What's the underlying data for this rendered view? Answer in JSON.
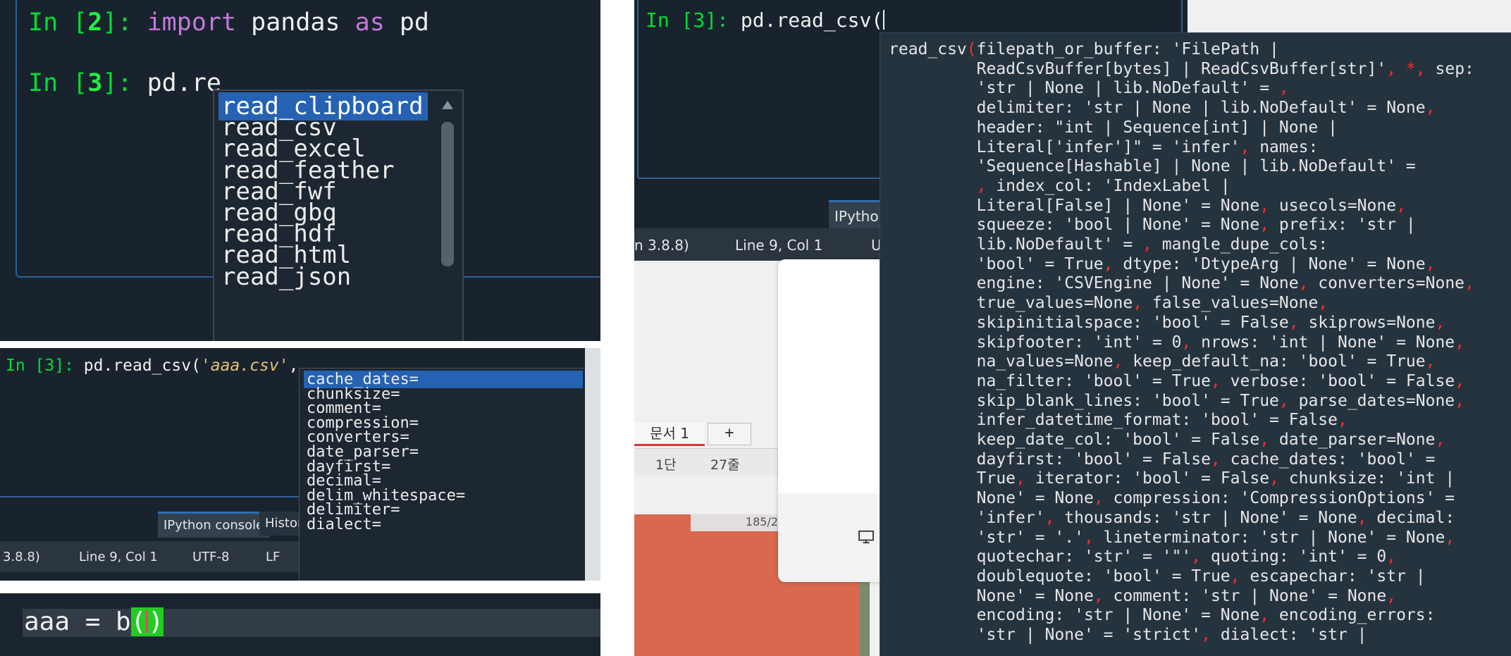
{
  "panelA": {
    "lines": [
      {
        "prompt_in": "In [",
        "num": "2",
        "prompt_close": "]:",
        "code": [
          {
            "kind": "kw",
            "text": "import"
          },
          {
            "kind": "plain",
            "text": " pandas "
          },
          {
            "kind": "kw",
            "text": "as"
          },
          {
            "kind": "plain",
            "text": " pd"
          }
        ]
      },
      {
        "prompt_in": "In [",
        "num": "3",
        "prompt_close": "]:",
        "code": [
          {
            "kind": "plain",
            "text": "pd.re"
          }
        ]
      }
    ],
    "completions": [
      "read_clipboard",
      "read_csv",
      "read_excel",
      "read_feather",
      "read_fwf",
      "read_gbq",
      "read_hdf",
      "read_html",
      "read_json"
    ],
    "selected_index": 0
  },
  "panelB": {
    "prompt": "In [3]:",
    "code_prefix": " pd.read_csv(",
    "code_string": "'aaa.csv'",
    "code_suffix": ",",
    "completions": [
      "cache_dates=",
      "chunksize=",
      "comment=",
      "compression=",
      "converters=",
      "date_parser=",
      "dayfirst=",
      "decimal=",
      "delim_whitespace=",
      "delimiter=",
      "dialect="
    ],
    "selected_index": 0,
    "tabs": [
      "IPython console",
      "Histor"
    ],
    "status": [
      "3.8.8)",
      "Line 9, Col 1",
      "UTF-8",
      "LF"
    ]
  },
  "panelC": {
    "code_before": "aaa = b",
    "paren_open": "(",
    "paren_close": ")"
  },
  "panelD": {
    "prompt": "In [3]:",
    "code": " pd.read_csv(",
    "tab": "IPytho",
    "status": [
      "n 3.8.8)",
      "Line 9, Col 1",
      "U"
    ],
    "hwp_tab": "문서 1",
    "plus_tab": "+",
    "ruler": [
      "1단",
      "27줄"
    ],
    "page_num": "185/2",
    "signature_lines": [
      "read_csv(filepath_or_buffer: 'FilePath |",
      "         ReadCsvBuffer[bytes] | ReadCsvBuffer[str]', *, sep:",
      "         'str | None | lib.NoDefault' = ,",
      "         delimiter: 'str | None | lib.NoDefault' = None,",
      "         header: \"int | Sequence[int] | None |",
      "         Literal['infer']\" = 'infer', names:",
      "         'Sequence[Hashable] | None | lib.NoDefault' =",
      "         , index_col: 'IndexLabel |",
      "         Literal[False] | None' = None, usecols=None,",
      "         squeeze: 'bool | None' = None, prefix: 'str |",
      "         lib.NoDefault' = , mangle_dupe_cols:",
      "         'bool' = True, dtype: 'DtypeArg | None' = None,",
      "         engine: 'CSVEngine | None' = None, converters=None,",
      "         true_values=None, false_values=None,",
      "         skipinitialspace: 'bool' = False, skiprows=None,",
      "         skipfooter: 'int' = 0, nrows: 'int | None' = None,",
      "         na_values=None, keep_default_na: 'bool' = True,",
      "         na_filter: 'bool' = True, verbose: 'bool' = False,",
      "         skip_blank_lines: 'bool' = True, parse_dates=None,",
      "         infer_datetime_format: 'bool' = False,",
      "         keep_date_col: 'bool' = False, date_parser=None,",
      "         dayfirst: 'bool' = False, cache_dates: 'bool' =",
      "         True, iterator: 'bool' = False, chunksize: 'int |",
      "         None' = None, compression: 'CompressionOptions' =",
      "         'infer', thousands: 'str | None' = None, decimal:",
      "         'str' = '.', lineterminator: 'str | None' = None,",
      "         quotechar: 'str' = '\"', quoting: 'int' = 0,",
      "         doublequote: 'bool' = True, escapechar: 'str |",
      "         None' = None, comment: 'str | None' = None,",
      "         encoding: 'str | None' = None, encoding_errors:",
      "         'str | None' = 'strict', dialect: 'str |"
    ]
  },
  "colors": {
    "panel_bg": "#19232d",
    "prompt_green": "#00dd33",
    "keyword": "#c678dd",
    "selection": "#2562b3",
    "separator_red": "#ff2b2b"
  }
}
